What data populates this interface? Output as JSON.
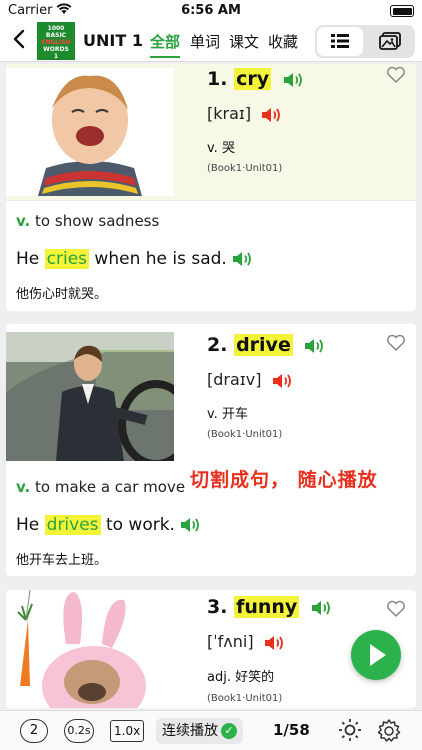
{
  "status": {
    "carrier": "Carrier",
    "time": "6:56 AM"
  },
  "nav": {
    "logo_line1": "1000",
    "logo_line2": "BASIC",
    "logo_line3": "ENGLISH",
    "logo_line4": "WORDS",
    "logo_line5": "1",
    "unit_title": "UNIT 1",
    "tabs": [
      {
        "label": "全部",
        "active": true
      },
      {
        "label": "单词",
        "active": false
      },
      {
        "label": "课文",
        "active": false
      },
      {
        "label": "收藏",
        "active": false
      }
    ]
  },
  "cards": [
    {
      "number": "1.",
      "word": "cry",
      "phonetic": "[kraɪ]",
      "pos_cn": "v. 哭",
      "book": "(Book1·Unit01)",
      "def_pos": "v.",
      "definition": "to show sadness",
      "sentence_pre": "He ",
      "sentence_word": "cries",
      "sentence_post": " when he is sad.",
      "translation": "他伤心时就哭。",
      "image": "crying-child-photo"
    },
    {
      "number": "2.",
      "word": "drive",
      "phonetic": "[draɪv]",
      "pos_cn": "v. 开车",
      "book": "(Book1·Unit01)",
      "def_pos": "v.",
      "definition": "to make a car move",
      "sentence_pre": "He ",
      "sentence_word": "drives",
      "sentence_post": " to work.",
      "translation": "他开车去上班。",
      "image": "man-driving-car-photo"
    },
    {
      "number": "3.",
      "word": "funny",
      "phonetic": "[ˈfʌni]",
      "pos_cn": "adj. 好笑的",
      "book": "(Book1·Unit01)",
      "image": "dog-in-bunny-costume-photo"
    }
  ],
  "promo_text": "切割成句， 随心播放",
  "toolbar": {
    "repeat_count": "2",
    "interval": "0.2s",
    "speed": "1.0x",
    "continuous_label": "连续播放",
    "page_indicator": "1/58"
  },
  "colors": {
    "accent_green": "#2aa33d",
    "highlight_yellow": "#f3f43a",
    "speaker_red": "#e8301e",
    "promo_red": "#e8301e"
  }
}
